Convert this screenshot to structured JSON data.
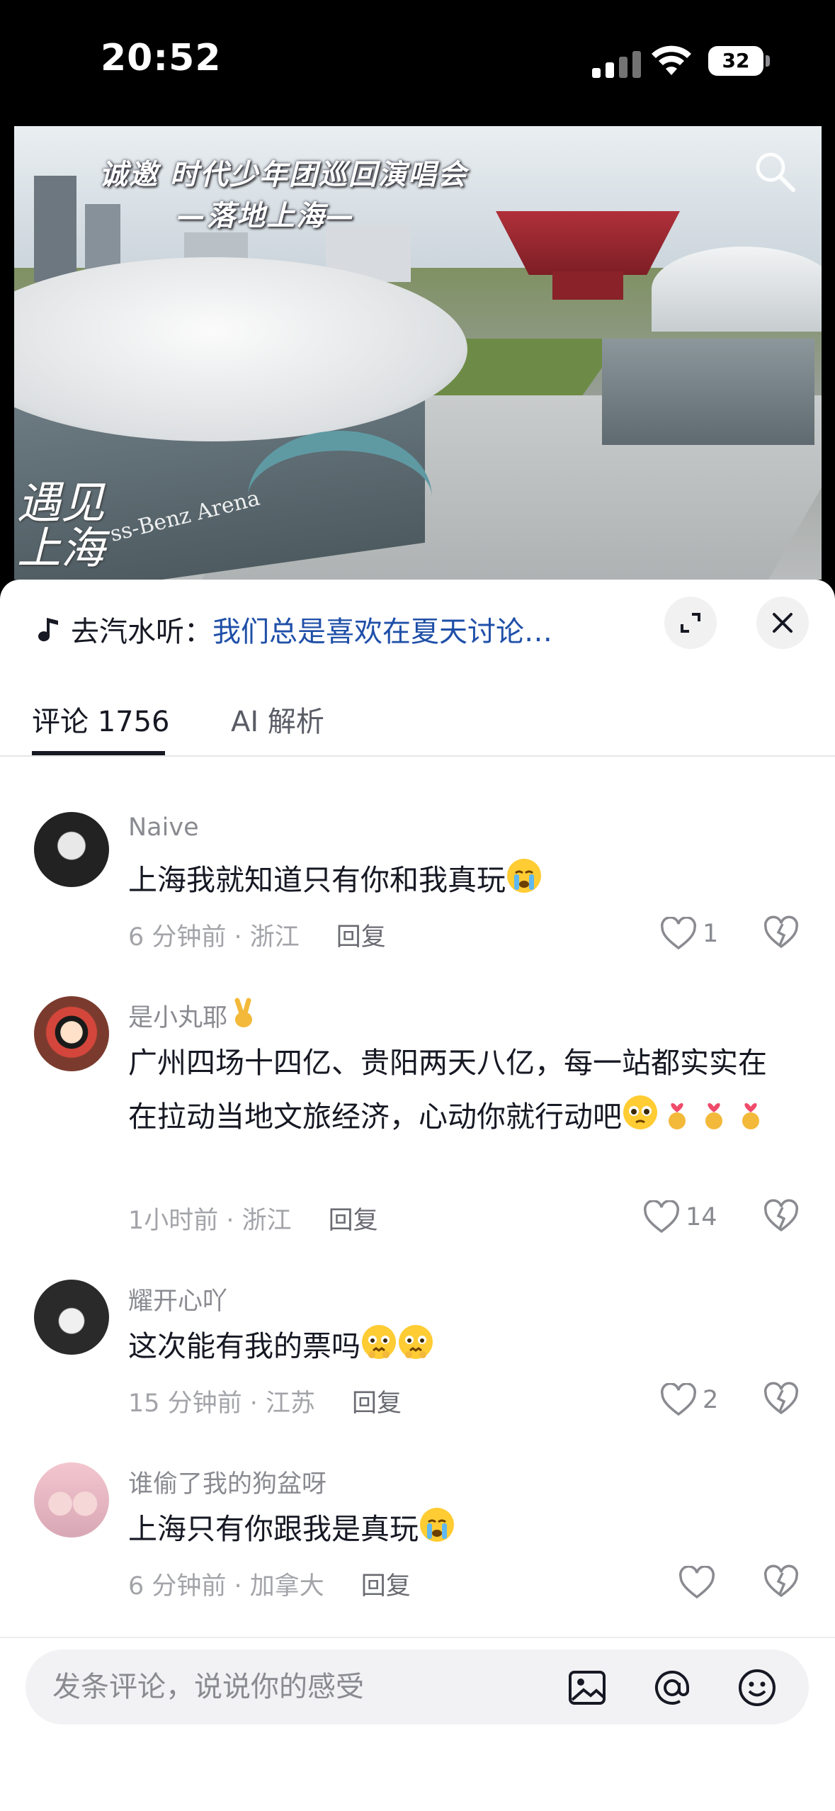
{
  "status_bar": {
    "time": "20:52",
    "battery": "32"
  },
  "video": {
    "title_line1": "诚邀 时代少年团巡回演唱会",
    "title_line2": "—落地上海—",
    "tag": "遇见\n上海",
    "arena_sign": "ss-Benz Arena",
    "search_icon": "search-icon"
  },
  "music": {
    "prefix": "去汽水听：",
    "title": "我们总是喜欢在夏天讨论…"
  },
  "tabs": [
    {
      "label": "评论 1756",
      "active": true
    },
    {
      "label": "AI 解析",
      "active": false
    }
  ],
  "comments": [
    {
      "name": "Naive",
      "text": "上海我就知道只有你和我真玩",
      "time": "6 分钟前 · 浙江",
      "reply": "回复",
      "likes": "1"
    },
    {
      "name": "是小丸耶",
      "text": "广州四场十四亿、贵阳两天八亿，每一站都实实在在拉动当地文旅经济，心动你就行动吧",
      "time": "1小时前 · 浙江",
      "reply": "回复",
      "likes": "14"
    },
    {
      "name": "耀开心吖",
      "text": "这次能有我的票吗",
      "time": "15 分钟前 · 江苏",
      "reply": "回复",
      "likes": "2"
    },
    {
      "name": "谁偷了我的狗盆呀",
      "text": "上海只有你跟我是真玩",
      "time": "6 分钟前 · 加拿大",
      "reply": "回复",
      "likes": ""
    }
  ],
  "input": {
    "placeholder": "发条评论，说说你的感受"
  },
  "colors": {
    "accent_link": "#1f4fa8",
    "text_primary": "#161823",
    "text_secondary": "#8a8b91"
  }
}
